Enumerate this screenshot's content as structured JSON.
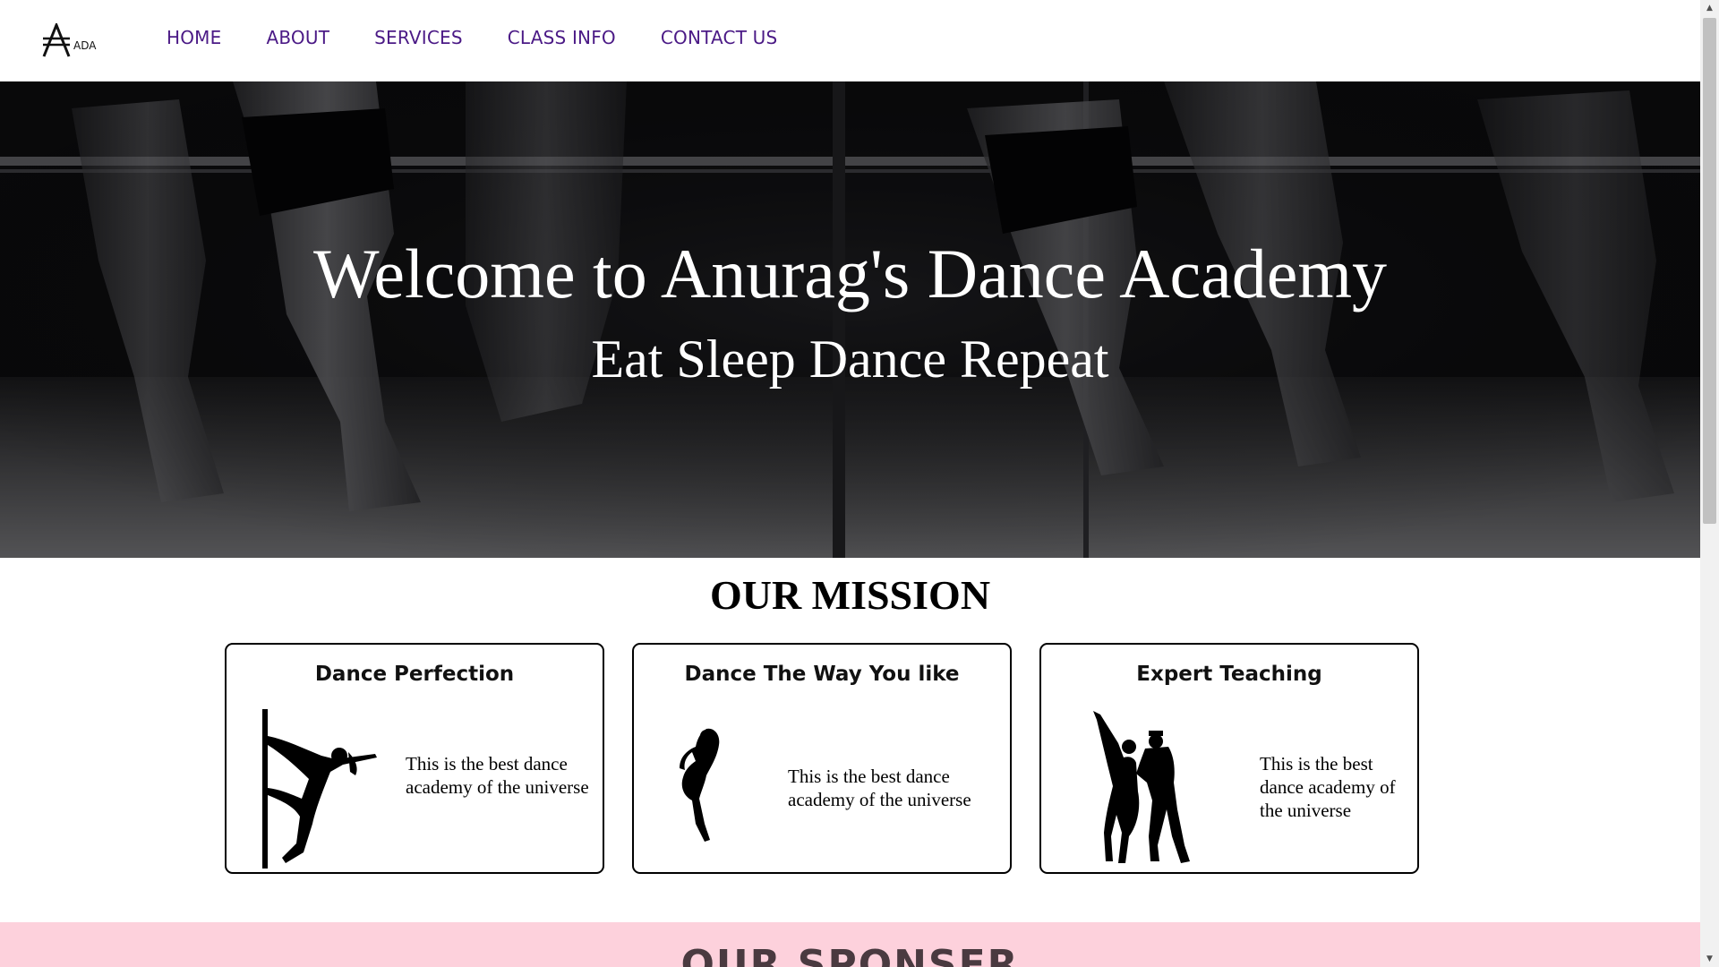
{
  "nav": {
    "logo_text": "ADA",
    "links": [
      "HOME",
      "ABOUT",
      "SERVICES",
      "CLASS INFO",
      "CONTACT US"
    ]
  },
  "hero": {
    "title": "Welcome to Anurag's Dance Academy",
    "subtitle": "Eat Sleep Dance Repeat"
  },
  "mission": {
    "heading": "OUR MISSION",
    "cards": [
      {
        "title": "Dance Perfection",
        "text": "This is the best dance academy of the universe",
        "icon": "pole-dancer-silhouette-icon"
      },
      {
        "title": "Dance The Way You like",
        "text": "This is the best dance academy of the universe",
        "icon": "ballet-dancer-silhouette-icon"
      },
      {
        "title": "Expert Teaching",
        "text": "This is the best dance academy of the universe",
        "icon": "dance-couple-silhouette-icon"
      }
    ]
  },
  "sponsor": {
    "heading": "OUR SPONSER"
  },
  "colors": {
    "nav_link": "#4b1a86",
    "sponsor_bg": "#fdd1dc",
    "hero_overlay": "#0b0b0d"
  }
}
